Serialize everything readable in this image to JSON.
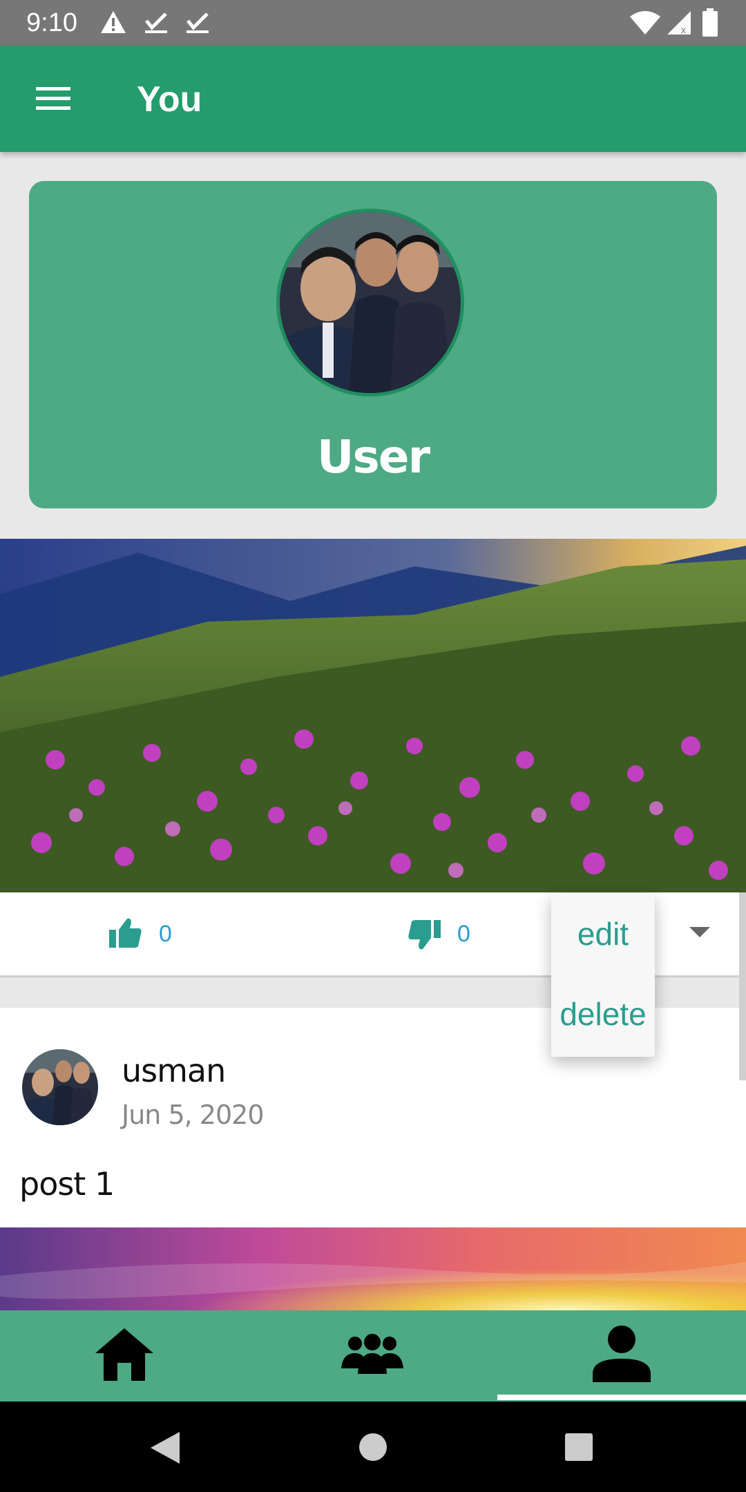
{
  "status_bar": {
    "time": "9:10",
    "icons": [
      "warning-icon",
      "check-icon",
      "check-icon",
      "wifi-icon",
      "signal-icon",
      "battery-icon"
    ]
  },
  "app_bar": {
    "title": "You",
    "menu_icon": "hamburger-menu-icon"
  },
  "profile": {
    "name": "User"
  },
  "post_1": {
    "likes": "0",
    "dislikes": "0",
    "menu": {
      "edit_label": "edit",
      "delete_label": "delete"
    }
  },
  "post_2": {
    "username": "usman",
    "date": "Jun 5, 2020",
    "text": "post 1"
  },
  "bottom_nav": {
    "items": [
      {
        "icon": "home-icon"
      },
      {
        "icon": "group-icon"
      },
      {
        "icon": "person-icon",
        "selected": true
      }
    ]
  },
  "colors": {
    "primary": "#249c6c",
    "card": "#4daa84",
    "accent_text": "#2a9d8f",
    "count_text": "#2a9dd0"
  }
}
